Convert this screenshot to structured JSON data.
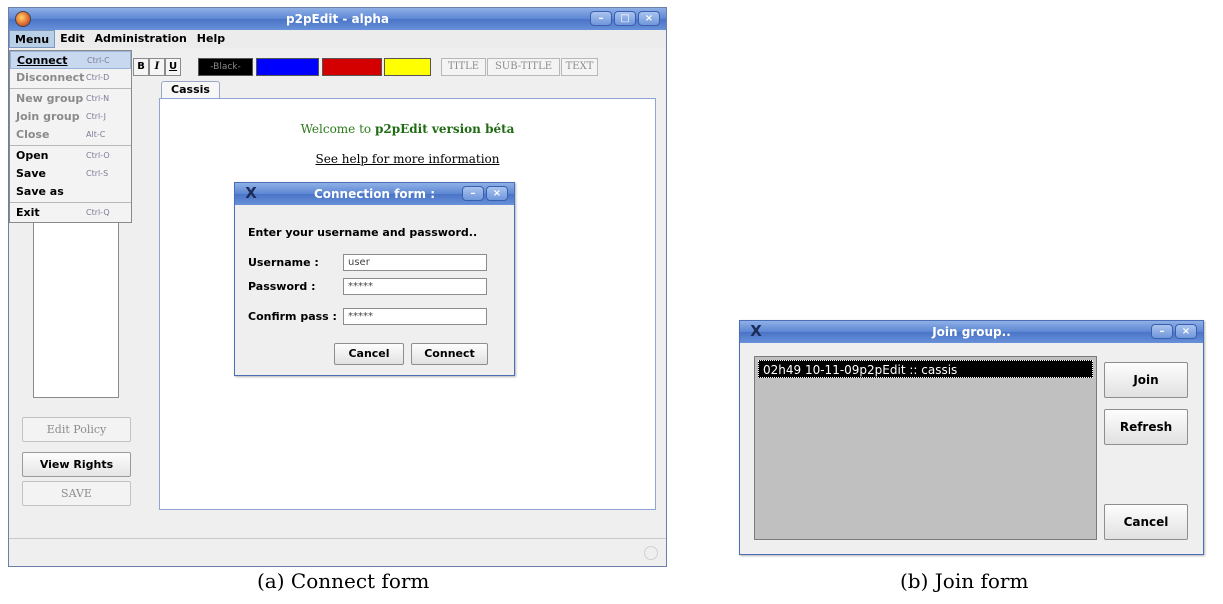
{
  "main_window": {
    "title": "p2pEdit - alpha",
    "menubar": [
      "Menu",
      "Edit",
      "Administration",
      "Help"
    ],
    "menu_items": [
      {
        "label": "Connect",
        "accel": "Ctrl-C",
        "enabled": true,
        "highlighted": true
      },
      {
        "label": "Disconnect",
        "accel": "Ctrl-D",
        "enabled": false
      },
      {
        "label": "New group",
        "accel": "Ctrl-N",
        "enabled": false
      },
      {
        "label": "Join group",
        "accel": "Ctrl-J",
        "enabled": false
      },
      {
        "label": "Close",
        "accel": "Alt-C",
        "enabled": false
      },
      {
        "label": "Open",
        "accel": "Ctrl-O",
        "enabled": true
      },
      {
        "label": "Save",
        "accel": "Ctrl-S",
        "enabled": true
      },
      {
        "label": "Save as",
        "accel": "",
        "enabled": true
      },
      {
        "label": "Exit",
        "accel": "Ctrl-Q",
        "enabled": true
      }
    ],
    "format_buttons": [
      "B",
      "I",
      "U"
    ],
    "colors": {
      "black_label": "-Black-",
      "black": "#000000",
      "blue": "#0000ff",
      "red": "#d40000",
      "yellow": "#ffff00"
    },
    "style_buttons": [
      "TITLE",
      "SUB-TITLE",
      "TEXT"
    ],
    "tab_label": "Cassis",
    "welcome_prefix": "Welcome to ",
    "welcome_bold": "p2pEdit version béta",
    "help_link": "See help for more information",
    "side_buttons": {
      "edit_policy": "Edit Policy",
      "view_rights": "View Rights",
      "save": "SAVE"
    }
  },
  "connection_form": {
    "title": "Connection form :",
    "prompt": "Enter your username and password..",
    "username_label": "Username :",
    "username_value": "user",
    "password_label": "Password :",
    "password_value": "*****",
    "confirm_label": "Confirm pass :",
    "confirm_value": "*****",
    "cancel": "Cancel",
    "connect": "Connect"
  },
  "join_form": {
    "title": "Join group..",
    "groups": [
      "02h49 10-11-09p2pEdit :: cassis"
    ],
    "join": "Join",
    "refresh": "Refresh",
    "cancel": "Cancel"
  },
  "captions": {
    "a": "(a) Connect form",
    "b": "(b) Join form"
  }
}
